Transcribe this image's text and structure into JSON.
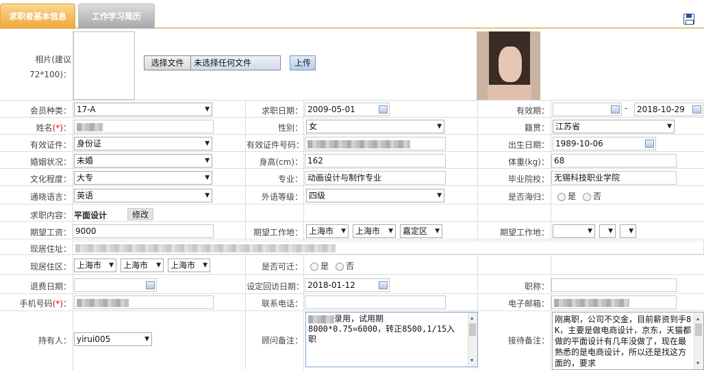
{
  "tabs": [
    "求职者基本信息",
    "工作学习简历"
  ],
  "photo": {
    "label": "相片(建议",
    "label2": "72*100)：",
    "file_button": "选择文件",
    "file_status": "未选择任何文件",
    "upload": "上传"
  },
  "member_type": {
    "label": "会员种类：",
    "value": "17-A"
  },
  "apply_date": {
    "label": "求职日期：",
    "value": "2009-05-01"
  },
  "valid_period": {
    "label": "有效期：",
    "from": "",
    "dash": "-",
    "to": "2018-10-29"
  },
  "name": {
    "label": "姓名",
    "req": "(*)",
    "colon": "："
  },
  "gender": {
    "label": "性别：",
    "value": "女"
  },
  "native": {
    "label": "籍贯：",
    "value": "江苏省"
  },
  "id_type": {
    "label": "有效证件：",
    "value": "身份证"
  },
  "id_no": {
    "label": "有效证件号码："
  },
  "birth": {
    "label": "出生日期：",
    "value": "1989-10-06"
  },
  "marital": {
    "label": "婚姻状况：",
    "value": "未婚"
  },
  "height": {
    "label": "身高(cm)：",
    "value": "162"
  },
  "weight": {
    "label": "体重(kg)：",
    "value": "68"
  },
  "education": {
    "label": "文化程度：",
    "value": "大专"
  },
  "major": {
    "label": "专业：",
    "value": "动画设计与制作专业"
  },
  "school": {
    "label": "毕业院校：",
    "value": "无锡科技职业学院"
  },
  "language": {
    "label": "通晓语言：",
    "value": "英语"
  },
  "foreign_level": {
    "label": "外语等级：",
    "value": "四级"
  },
  "returnee": {
    "label": "是否海归：",
    "yes": "是",
    "no": "否"
  },
  "job_content": {
    "label": "求职内容：",
    "value": "平面设计",
    "modify": "修改"
  },
  "salary": {
    "label": "期望工资：",
    "value": "9000"
  },
  "work_place1": {
    "label": "期望工作地：",
    "v1": "上海市",
    "v2": "上海市",
    "v3": "嘉定区"
  },
  "work_place2": {
    "label": "期望工作地：",
    "v1": "",
    "v2": "",
    "v3": ""
  },
  "address": {
    "label": "现居住址："
  },
  "district": {
    "label": "现居住区：",
    "v1": "上海市",
    "v2": "上海市",
    "v3": "上海市"
  },
  "relocate": {
    "label": "是否可迁：",
    "yes": "是",
    "no": "否"
  },
  "refund_date": {
    "label": "退费日期：",
    "value": ""
  },
  "revisit_date": {
    "label": "设定回访日期：",
    "value": "2018-01-12"
  },
  "title": {
    "label": "职称：",
    "value": ""
  },
  "mobile": {
    "label": "手机号码",
    "req": "(*)",
    "colon": "："
  },
  "phone": {
    "label": "联系电话：",
    "value": ""
  },
  "email": {
    "label": "电子邮箱："
  },
  "holder": {
    "label": "持有人：",
    "value": "yirui005"
  },
  "consultant_note": {
    "label": "顾问备注：",
    "line1": "录用，试用期",
    "line2": "8000*0.75=6000，转正8500,1/15入",
    "line3": "职"
  },
  "reception_note": {
    "label": "接待备注：",
    "text": "刚离职，公司不交金，目前薪资到手8K，主要是做电商设计，京东，天猫都做的平面设计有几年没做了，现在最熟悉的是电商设计，所以还是找这方面的，要求"
  }
}
